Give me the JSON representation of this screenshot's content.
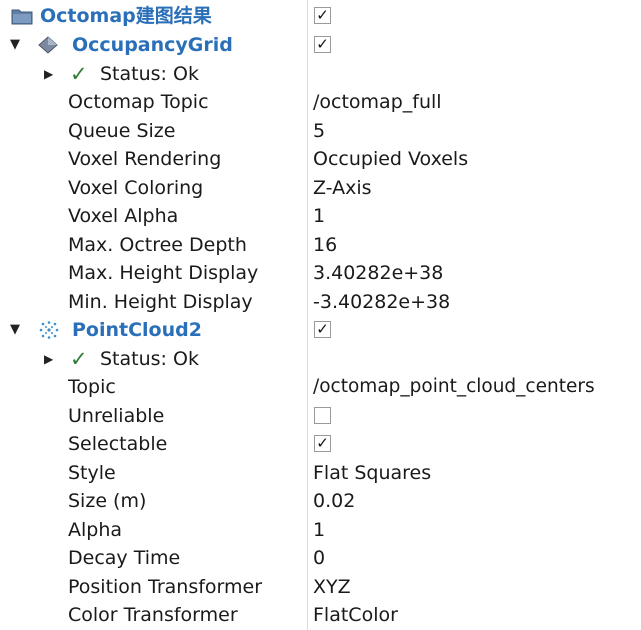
{
  "root": {
    "label": "Octomap建图结果",
    "enabled": true
  },
  "occupancy": {
    "label": "OccupancyGrid",
    "enabled": true,
    "status": "Status: Ok",
    "props": [
      {
        "name": "Octomap Topic",
        "value": "/octomap_full"
      },
      {
        "name": "Queue Size",
        "value": "5"
      },
      {
        "name": "Voxel Rendering",
        "value": "Occupied Voxels"
      },
      {
        "name": "Voxel Coloring",
        "value": "Z-Axis"
      },
      {
        "name": "Voxel Alpha",
        "value": "1"
      },
      {
        "name": "Max. Octree Depth",
        "value": "16"
      },
      {
        "name": "Max. Height Display",
        "value": "3.40282e+38"
      },
      {
        "name": "Min. Height Display",
        "value": "-3.40282e+38"
      }
    ]
  },
  "pointcloud": {
    "label": "PointCloud2",
    "enabled": true,
    "status": "Status: Ok",
    "topic": {
      "name": "Topic",
      "value": "/octomap_point_cloud_centers"
    },
    "unreliable": {
      "name": "Unreliable",
      "checked": false
    },
    "selectable": {
      "name": "Selectable",
      "checked": true
    },
    "props": [
      {
        "name": "Style",
        "value": "Flat Squares"
      },
      {
        "name": "Size (m)",
        "value": "0.02"
      },
      {
        "name": "Alpha",
        "value": "1"
      },
      {
        "name": "Decay Time",
        "value": "0"
      },
      {
        "name": "Position Transformer",
        "value": "XYZ"
      },
      {
        "name": "Color Transformer",
        "value": "FlatColor"
      }
    ]
  },
  "icons": {
    "expand_arrow": "▼",
    "collapsed_arrow": "▶",
    "status_check": "✓",
    "checkbox_mark": "✓"
  }
}
